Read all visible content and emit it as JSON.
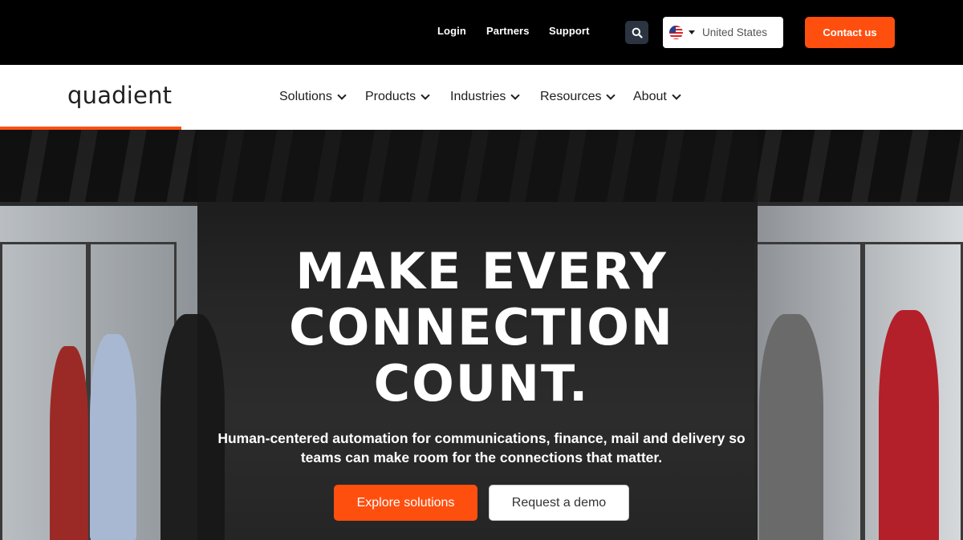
{
  "topbar": {
    "links": [
      "Login",
      "Partners",
      "Support"
    ],
    "search_icon": "search-icon",
    "country": "United States",
    "contact_label": "Contact us"
  },
  "nav": {
    "logo": "quadient",
    "items": [
      "Solutions",
      "Products",
      "Industries",
      "Resources",
      "About"
    ]
  },
  "hero": {
    "headline_lines": [
      "MAKE EVERY",
      "CONNECTION",
      "COUNT."
    ],
    "subtitle_lines": [
      "Human-centered automation for communications, finance, mail and delivery so",
      "teams can make room for the connections that matter."
    ],
    "primary_cta": "Explore solutions",
    "secondary_cta": "Request a demo"
  },
  "colors": {
    "accent": "#ff4f0f",
    "topbar_bg": "#000000",
    "nav_bg": "#ffffff"
  }
}
